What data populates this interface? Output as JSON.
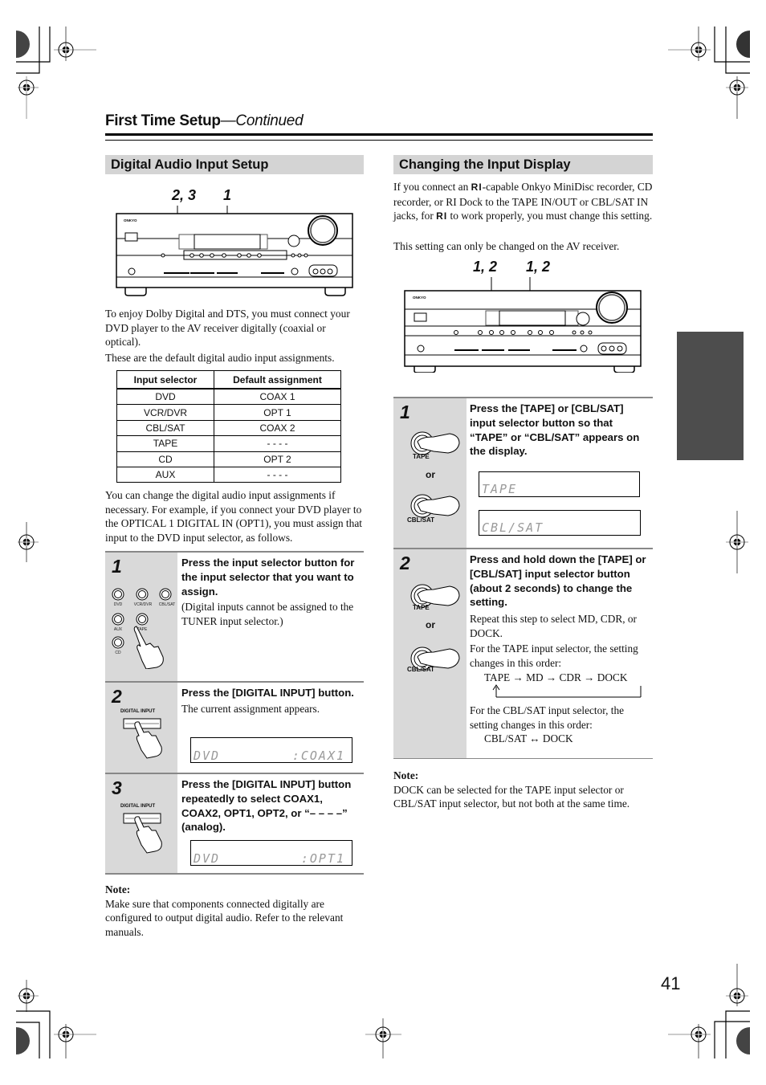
{
  "header": {
    "title": "First Time Setup",
    "title_suffix": "—Continued"
  },
  "left": {
    "section_title": "Digital Audio Input Setup",
    "callouts": [
      "2, 3",
      "1"
    ],
    "intro_1": "To enjoy Dolby Digital and DTS, you must connect your DVD player to the AV receiver digitally (coaxial or optical).",
    "intro_2": "These are the default digital audio input assignments.",
    "table": {
      "headers": [
        "Input selector",
        "Default assignment"
      ],
      "rows": [
        [
          "DVD",
          "COAX 1"
        ],
        [
          "VCR/DVR",
          "OPT 1"
        ],
        [
          "CBL/SAT",
          "COAX 2"
        ],
        [
          "TAPE",
          "- - - -"
        ],
        [
          "CD",
          "OPT 2"
        ],
        [
          "AUX",
          "- - - -"
        ]
      ]
    },
    "after_table": "You can change the digital audio input assignments if necessary. For example, if you connect your DVD player to the OPTICAL 1 DIGITAL IN (OPT1), you must assign that input to the DVD input selector, as follows.",
    "steps": [
      {
        "number": "1",
        "heading": "Press the input selector button for the input selector that you want to assign.",
        "body": "(Digital inputs cannot be assigned to the TUNER input selector.)",
        "button_labels": [
          "DVD",
          "VCR/DVR",
          "CBL/SAT",
          "AUX",
          "TAPE",
          "CD"
        ]
      },
      {
        "number": "2",
        "heading": "Press the [DIGITAL INPUT] button.",
        "body": "The current assignment appears.",
        "button_label": "DIGITAL INPUT",
        "display_left": "DVD",
        "display_right": ":COAX1"
      },
      {
        "number": "3",
        "heading": "Press the [DIGITAL INPUT] button repeatedly to select COAX1, COAX2, OPT1, OPT2, or “– – – –” (analog).",
        "button_label": "DIGITAL INPUT",
        "display_left": "DVD",
        "display_right": ":OPT1"
      }
    ],
    "note_title": "Note:",
    "note_body": "Make sure that components connected digitally are configured to output digital audio. Refer to the relevant manuals."
  },
  "right": {
    "section_title": "Changing the Input Display",
    "intro_a": "If you connect an ",
    "ri_symbol": "RI",
    "intro_b": "-capable Onkyo MiniDisc recorder, CD recorder, or RI Dock to the TAPE IN/OUT or CBL/SAT IN jacks, for ",
    "intro_c": " to work properly, you must change this setting.",
    "intro_2": "This setting can only be changed on the AV receiver.",
    "callouts": [
      "1, 2",
      "1, 2"
    ],
    "steps": [
      {
        "number": "1",
        "heading": "Press the [TAPE] or [CBL/SAT] input selector button so that “TAPE” or “CBL/SAT” appears on the display.",
        "label_a": "TAPE",
        "or": "or",
        "label_b": "CBL/SAT",
        "display_1": "TAPE",
        "display_2": "CBL/SAT"
      },
      {
        "number": "2",
        "heading": "Press and hold down the [TAPE] or [CBL/SAT] input selector button (about 2 seconds) to change the setting.",
        "label_a": "TAPE",
        "or": "or",
        "label_b": "CBL/SAT",
        "p1": "Repeat this step to select MD, CDR, or DOCK.",
        "p2": "For the TAPE input selector, the setting changes in this order:",
        "sequence_tape": "TAPE → MD → CDR → DOCK",
        "p3": "For the CBL/SAT input selector, the setting changes in this order:",
        "sequence_cblsat": "CBL/SAT ↔ DOCK"
      }
    ],
    "note_title": "Note:",
    "note_body": "DOCK can be selected for the TAPE input selector or CBL/SAT input selector, but not both at the same time."
  },
  "device": {
    "brand": "ONKYO"
  },
  "page_number": "41"
}
